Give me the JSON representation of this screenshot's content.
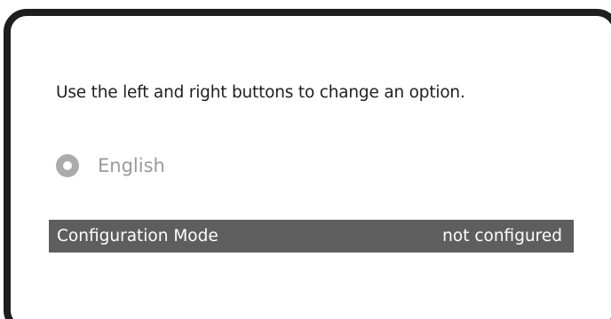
{
  "dialog": {
    "instruction": "Use the left and right buttons to change an option.",
    "language_option": {
      "icon": "radio-icon",
      "label": "English"
    },
    "config_row": {
      "label": "Configuration Mode",
      "value": "not configured"
    }
  }
}
